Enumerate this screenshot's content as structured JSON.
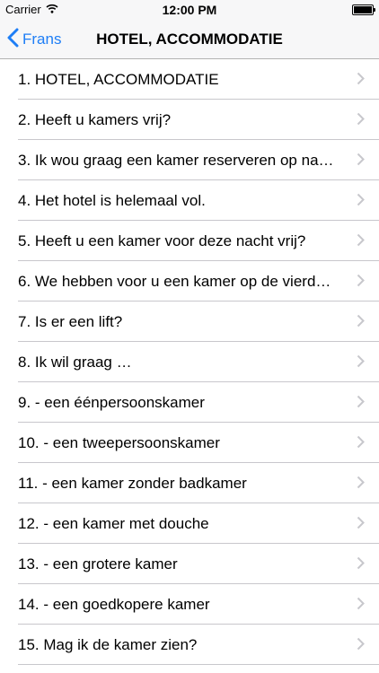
{
  "status": {
    "carrier": "Carrier",
    "time": "12:00 PM"
  },
  "nav": {
    "back_label": "Frans",
    "title": "HOTEL, ACCOMMODATIE"
  },
  "colors": {
    "accent": "#1e7ef6",
    "separator": "#c8c7cc",
    "chevron": "#c7c7cc"
  },
  "items": [
    {
      "label": "1. HOTEL, ACCOMMODATIE"
    },
    {
      "label": "2. Heeft u kamers vrij?"
    },
    {
      "label": "3. Ik wou graag een kamer reserveren op na…"
    },
    {
      "label": "4. Het hotel is helemaal vol."
    },
    {
      "label": "5. Heeft u een kamer voor deze nacht vrij?"
    },
    {
      "label": "6. We hebben voor u een kamer op de vierd…"
    },
    {
      "label": "7. Is er een lift?"
    },
    {
      "label": "8. Ik wil graag …"
    },
    {
      "label": "9. - een éénpersoonskamer"
    },
    {
      "label": "10. - een tweepersoonskamer"
    },
    {
      "label": "11. - een kamer zonder badkamer"
    },
    {
      "label": "12. - een kamer met douche"
    },
    {
      "label": "13. - een grotere kamer"
    },
    {
      "label": "14. - een goedkopere kamer"
    },
    {
      "label": "15. Mag ik de kamer zien?"
    }
  ]
}
